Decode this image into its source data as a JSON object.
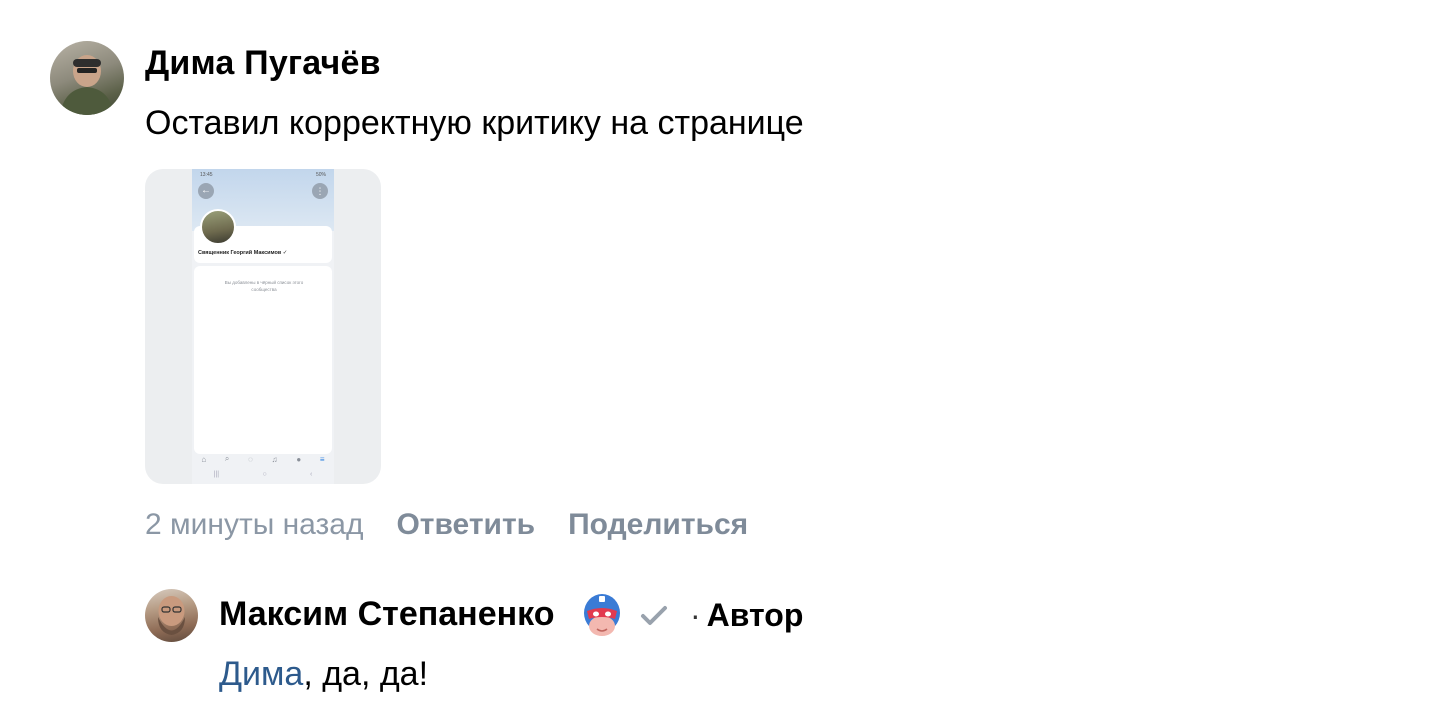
{
  "comment": {
    "author": "Дима Пугачёв",
    "text": "Оставил корректную критику на странице",
    "time": "2 минуты назад",
    "reply_label": "Ответить",
    "share_label": "Поделиться",
    "attachment": {
      "status_time": "13:45",
      "status_right": "50%",
      "profile_name": "Священник Георгий Максимов ✓",
      "message": "Вы добавлены в чёрный список этого сообщества"
    }
  },
  "reply": {
    "author": "Максим Степаненко",
    "badge_sep": "·",
    "badge": "Автор",
    "mention": "Дима",
    "text_rest": ", да, да!"
  },
  "colors": {
    "meta_text": "#8b97a5",
    "mention": "#2d5a8c",
    "verified_check": "#99a2ad"
  }
}
